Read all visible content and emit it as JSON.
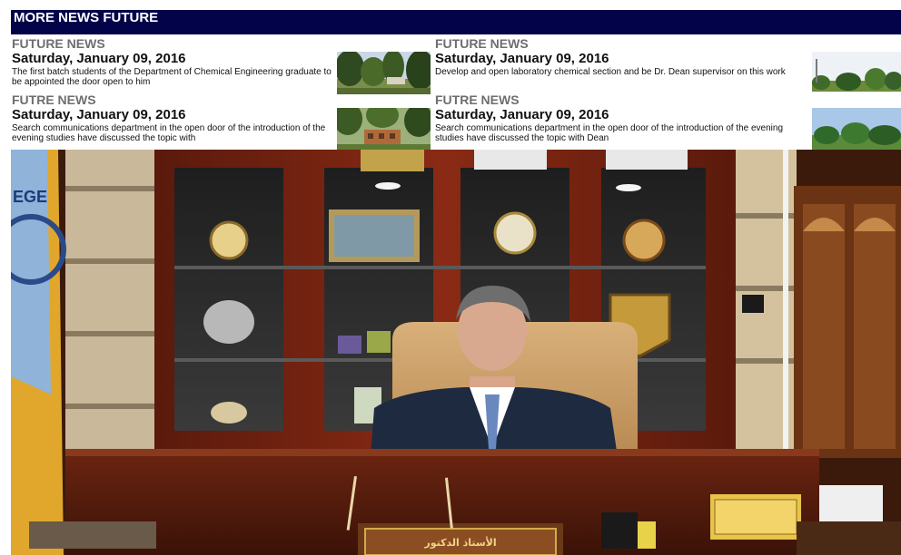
{
  "header": {
    "title": "MORE NEWS FUTURE"
  },
  "news": [
    {
      "category": "FUTURE NEWS",
      "date": "Saturday, January 09, 2016",
      "summary": "The first batch students of the Department of Chemical Engineering graduate to be appointed the door open to him"
    },
    {
      "category": "FUTURE NEWS",
      "date": "Saturday, January 09, 2016",
      "summary": "Develop and open laboratory chemical section and be Dr. Dean supervisor on this work"
    },
    {
      "category": "FUTRE NEWS",
      "date": "Saturday, January 09, 2016",
      "summary": "Search communications department in the open door of the introduction of the evening studies have discussed the topic with"
    },
    {
      "category": "FUTRE NEWS",
      "date": "Saturday, January 09, 2016",
      "summary": "Search communications department in the open door of the introduction of the evening studies have discussed the topic with Dean"
    }
  ],
  "photo": {
    "nameplate_text": "الأستاذ الدكتور",
    "banner_text": "EGE"
  },
  "colors": {
    "header_bg": "#03034a",
    "category_gray": "#6e6e6e"
  }
}
